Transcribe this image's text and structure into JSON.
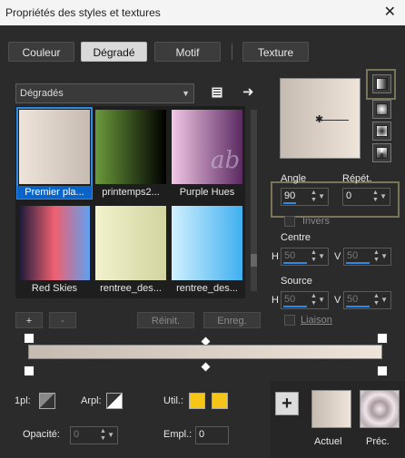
{
  "window": {
    "title": "Propriétés des styles et textures",
    "close_label": "✕"
  },
  "tabs": [
    {
      "label": "Couleur"
    },
    {
      "label": "Dégradé"
    },
    {
      "label": "Motif"
    },
    {
      "label": "Texture"
    }
  ],
  "category_select": {
    "value": "Dégradés"
  },
  "gallery": {
    "items": [
      {
        "label": "Premier pla...",
        "colors": [
          "#efe4da",
          "#c6bbb1"
        ],
        "selected": true
      },
      {
        "label": "printemps2...",
        "colors": [
          "#6a9a3a",
          "#000000"
        ]
      },
      {
        "label": "Purple Hues",
        "colors": [
          "#f2c6e6",
          "#5a2a60"
        ]
      },
      {
        "label": "Red Skies",
        "colors": [
          "#1a1a3a",
          "#f06070",
          "#60a0f0"
        ]
      },
      {
        "label": "rentree_des...",
        "colors": [
          "#f2f2cc",
          "#d2d4a0"
        ]
      },
      {
        "label": "rentree_des...",
        "colors": [
          "#d0f0ff",
          "#40b0f0"
        ]
      }
    ]
  },
  "gallery_buttons": {
    "add": "+",
    "remove": "-",
    "reset": "Réinit.",
    "save": "Enreg."
  },
  "angle": {
    "label": "Angle",
    "value": "90",
    "level_pct": 30
  },
  "repeat": {
    "label": "Répét.",
    "value": "0"
  },
  "invert": {
    "label": "Invers"
  },
  "center": {
    "label": "Centre",
    "h_label": "H",
    "h_value": "50",
    "v_label": "V",
    "v_value": "50"
  },
  "source": {
    "label": "Source",
    "h_label": "H",
    "h_value": "50",
    "v_label": "V",
    "v_value": "50"
  },
  "link": {
    "label": "Liaison"
  },
  "gradient_bar": {
    "colors": [
      "#c6bbb1",
      "#efe4da"
    ]
  },
  "bottom": {
    "first_label": "1pl:",
    "back_label": "Arpl:",
    "use_label": "Util.:",
    "opacity_label": "Opacité:",
    "opacity_value": "0",
    "position_label": "Empl.:",
    "position_value": "0",
    "use_colors": [
      "#f5c518",
      "#f5c518"
    ]
  },
  "result": {
    "current_label": "Actuel",
    "previous_label": "Préc.",
    "add": "+"
  },
  "watermark": "ab"
}
